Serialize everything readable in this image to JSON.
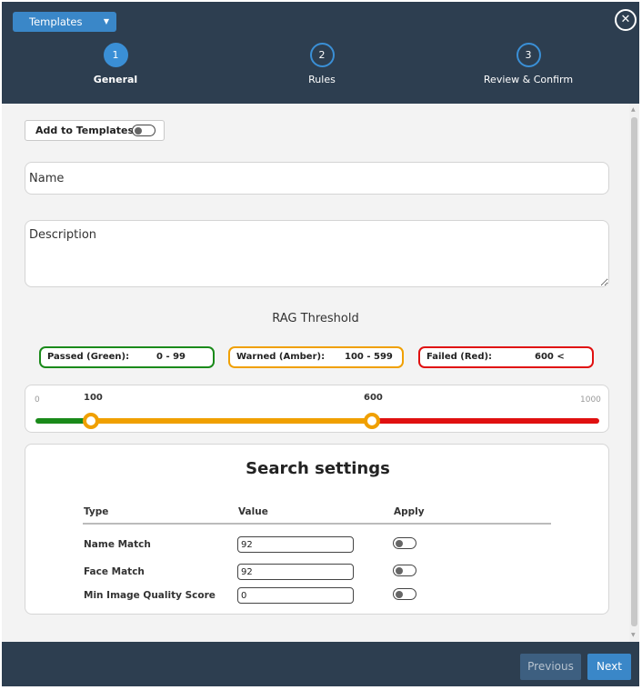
{
  "header": {
    "template_select": "Templates",
    "close_icon": "close-circle-icon",
    "steps": [
      {
        "number": "1",
        "label": "General",
        "active": true
      },
      {
        "number": "2",
        "label": "Rules",
        "active": false
      },
      {
        "number": "3",
        "label": "Review & Confirm",
        "active": false
      }
    ]
  },
  "form": {
    "add_to_templates_label": "Add to Templates",
    "add_to_templates_on": false,
    "name_placeholder": "Name",
    "name_value": "",
    "description_placeholder": "Description",
    "description_value": ""
  },
  "rag": {
    "title": "RAG Threshold",
    "passed_label": "Passed (Green):",
    "passed_range": "0 - 99",
    "warned_label": "Warned (Amber):",
    "warned_range": "100 - 599",
    "failed_label": "Failed (Red):",
    "failed_range": "600 <",
    "slider": {
      "min": "0",
      "max": "1000",
      "low_handle": "100",
      "high_handle": "600",
      "colors": {
        "green": "#1a8a1a",
        "amber": "#f0a000",
        "red": "#e01010"
      }
    }
  },
  "search": {
    "title": "Search settings",
    "headers": {
      "type": "Type",
      "value": "Value",
      "apply": "Apply"
    },
    "rows": [
      {
        "type": "Name Match",
        "value": "92",
        "apply": false
      },
      {
        "type": "Face Match",
        "value": "92",
        "apply": false
      },
      {
        "type": "Min Image Quality Score",
        "value": "0",
        "apply": false
      }
    ]
  },
  "footer": {
    "previous": "Previous",
    "next": "Next"
  },
  "colors": {
    "header_bg": "#2d3e50",
    "accent": "#3a87c8",
    "next_bg": "#3a87c8",
    "previous_bg": "#3d5f80"
  }
}
